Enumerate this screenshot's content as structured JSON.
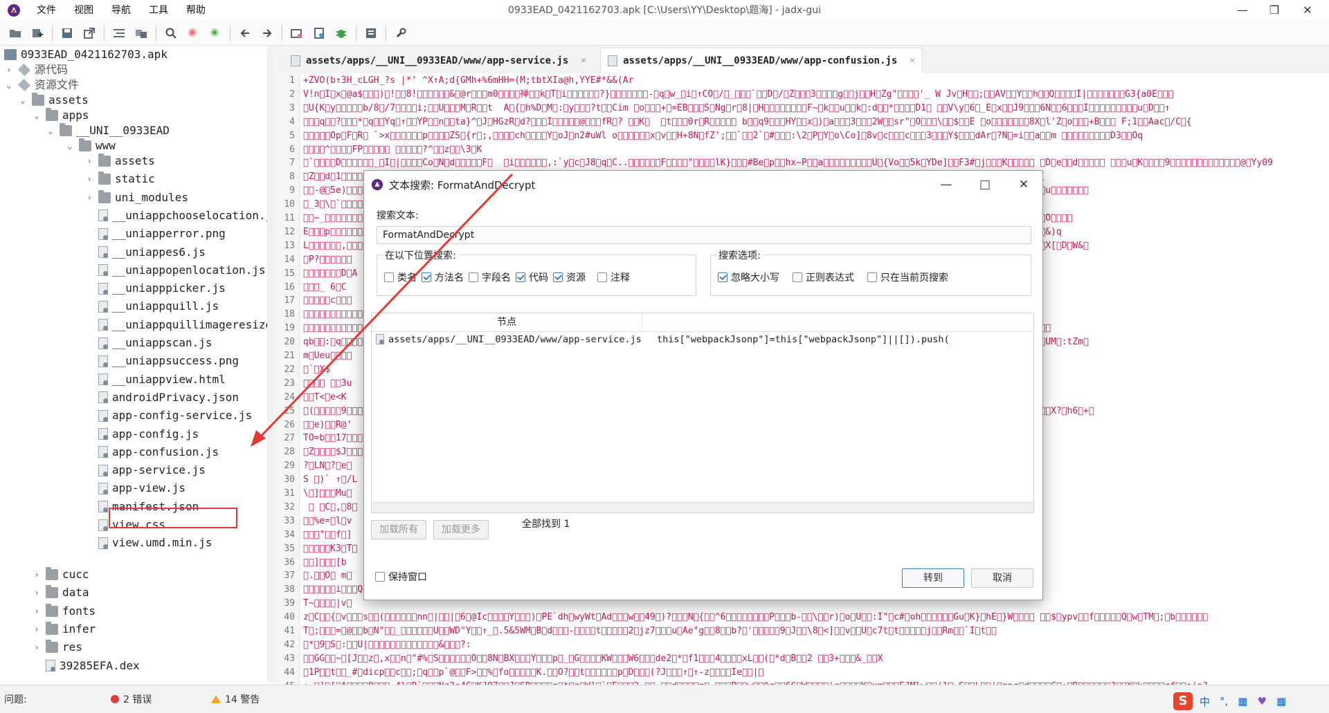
{
  "window": {
    "title": "0933EAD_0421162703.apk [C:\\Users\\YY\\Desktop\\题海] - jadx-gui",
    "menu": [
      "文件",
      "视图",
      "导航",
      "工具",
      "帮助"
    ],
    "controls": {
      "minimize": "—",
      "maximize": "❐",
      "close": "✕"
    }
  },
  "tabs": [
    {
      "label": "assets/apps/__UNI__0933EAD/www/app-service.js",
      "close": "✕"
    },
    {
      "label": "assets/apps/__UNI__0933EAD/www/app-confusion.js",
      "close": "✕"
    }
  ],
  "tree": {
    "root": "0933EAD_0421162703.apk",
    "source": "源代码",
    "resources": "资源文件",
    "assets": "assets",
    "apps": "apps",
    "uni": "__UNI__0933EAD",
    "www": "www",
    "items": [
      "assets",
      "static",
      "uni_modules",
      "__uniappchooselocation.js",
      "__uniapperror.png",
      "__uniappes6.js",
      "__uniappopenlocation.js",
      "__uniapppicker.js",
      "__uniappquill.js",
      "__uniappquillimageresize.js",
      "__uniappscan.js",
      "__uniappsuccess.png",
      "__uniappview.html",
      "androidPrivacy.json",
      "app-config-service.js",
      "app-config.js",
      "app-confusion.js",
      "app-service.js",
      "app-view.js",
      "manifest.json",
      "view.css",
      "view.umd.min.js"
    ],
    "after": [
      "cucc",
      "data",
      "fonts",
      "infer",
      "res",
      "39285EFA.dex"
    ]
  },
  "editor": {
    "line_numbers": [
      "1",
      "2",
      "3",
      "4",
      "5",
      "6",
      "7",
      "8",
      "9",
      "10",
      "11",
      "12",
      "13",
      "14",
      "15",
      "16",
      "17",
      "18",
      "19",
      "20",
      "21",
      "22",
      "23",
      "24",
      "25",
      "26",
      "27",
      "28",
      "29",
      "30",
      "31",
      "32",
      "33",
      "34",
      "35",
      "36",
      "37",
      "38",
      "39",
      "40",
      "41",
      "42",
      "43",
      "44",
      "45"
    ],
    "lines": [
      "\u0001+\u0000\u0001ZVO(\u0000\u0000b\u0000↑\u0000\u0000\u00003\u0000\u0000\u0000H\u0000_cL\u0000GH_?\u0000\u0000\u0000s\u0000 |*\u0000\u0000'\u0000\u0000\u0000 ^X\u0000↑\u0000\u0000A;\u0000\u0000d\u0000{\u0000G\u0000M\u0000\u0000\u0000\u0000\u0000h+\u0000\u0000%\u00006m\u0000H\u0000H\u0000\u0000\u0000\u0000=\u0000\u0000\u0000\u0000\u0000\u0000(\u0000\u0000\u0000\u0000\u0000M;\u0000\u0000\u0000t\u0000b\u0000tX\u0000\u0000\u0000I\u0000\u0000\u0000a@\u0000h\u0000\u0000,Y\u0000YE\u0000#*\u0000\u0000&\u0000\u0000\u0000&\u0000(\u0000A\u0000\u0000\u0000\u0000\u0000\u0000\u0000r\u0000\u0000\u0000",
      "V!n\u0000I\u0000x\u0000@a$\u0000\u0000\u0000)\u0000!\u0000\u00008!\u0000\u0000\u0000\u0000\u0000\u0000&\u0000@r\u0000\u0000\u0000m0\u0000\u0000\u0000\u0000禅\u0000\u0000k\u0000T\u0000i\u0000\u0000\u0000\u0000\u0000\u0000?}\u0000\u0000\u0000\u0000\u0000\u0000\u0000-\u0000q\u0000w_\u0000i\u0000↑CO\u0000/\u0000_\u0000\u0000\u0000`\u0000\u0000D\u0000/\u0000Z\u0000\u0000\u00003\u0000\u0000\u0000\u0000g\u0000\u0000j\u0000\u0000H\u0000Zg\"\u0000\u0000\u0000\u0000'_ W Jv\u0000H\u0000\u0000;\u0000\u0000AV\u0000\u0000Y\u0000\u0000h\u0000\u0000Q\u0000\u0000\u0000\u0000I|\u0000\u0000\u0000\u0000\u0000\u0000\u0000G3{a0E\u0000\u0000\u0000",
      "\u0000U{K\u0000y\u0000\u0000\u0000\u0000\u0000b/8\u0000/7\u0000\u0000\u0000\u0000i;\u0000\u0000U\u0000\u0000\u0000M\u0000R\u0000\u0000t  A\u0000{\u0000h%D\u0000M\u0000:\u0000y\u0000\u0000\u0000?t\u0000\u0000Cim \u0000o\u0000\u0000\u0000+\u0000=EB\u0000\u0000\u0000S\u0000Ng\u0000r\u00008|\u0000H\u0000\u0000\u0000\u0000\u0000\u0000\u0000\u0000F~\u0000k\u0000\u0000u\u0000\u0000k\u0000:d\u0000\u0000*\u0000\u0000\u0000\u0000D1\u0000 \u0000\u0000V\\y\u00006\u0000_E\u0000x\u0000\u0000J9\u0000\u0000\u00006N\u0000\u00006\u0000\u0000\u0000I\u0000\u0000\u0000\u0000\u0000\u0000\u0000\u0000\u0000u\u0000D\u0000\u0000↑",
      "\u0000\u0000\u0000q\u0000\u0000?\u0000\u0000\u0000*\u0000q\u0000\u0000Yq\u0000↑\u0000\u0000YP\u0000\u0000n\u0000\u0000ta}^\u0000J\u0000HGzR\u0000d?\u0000\u0000\u0000I\u0000\u0000\u0000\u0000\u0000@\u0000\u0000\u0000fR\u0000? \u0000\u0000K\u0000  \u0000t\u0000\u0000\u00000r\u0000R\u0000\u0000\u0000\u0000\u0000 b\u0000\u0000q9\u0000\u0000\u0000HY\u0000\u0000x\u0000)\u0000a\u0000\u0000\u00003\u0000\u0000\u00002W\u0000\u0000sr\"\u0000O\u0000\u0000\u0000\\\u0000\u0000$\u0000\u0000E \u0000o\u0000\u0000\u0000\u0000\u0000\u0000\u00008X\u0000l'Z\u0000o\u0000\u0000\u0000+B\u0000\u0000\u0000 F;1\u0000\u0000Aac\u0000/C\u0000{",
      "\u0000\u0000\u0000\u0000\u0000Op\u0000F\u0000R\u0000 `>x\u0000\u0000\u0000\u0000\u0000\u0000p\u0000\u0000\u0000\u0000ZS\u0000{r\u0000;,\u0000\u0000\u0000\u0000ch\u0000\u0000\u0000\u0000Y\u0000oJ\u0000n2#uWl o\u0000\u0000\u0000\u0000\u0000\u0000x\u0000v\u0000\u0000H+8N\u0000fZ';\u0000\u0000`\u0000\u00002`\u0000#\u0000\u0000\u0000:\\2\u0000P\u0000Y\u0000o\\Co]\u00008v\u0000c\u0000\u0000\u0000c\u0000\u0000\u00003\u0000\u0000\u0000Y$\u0000\u0000\u0000dAr\u0000?N\u0000=i\u0000\u0000a\u0000\u0000m \u0000\u0000\u0000\u0000\u0000\u0000\u0000\u0000\u0000D3\u0000\u0000Oq",
      "\u0000\u0000\u0000\u0000^\u0000\u0000\u0000\u0000FP\u0000\u0000\u0000\u0000\u0000 \u0000\u0000\u0000\u0000\u0000?^\u0000\u0000z\u0000\u0000\\3\u0000K",
      "\u0000`\u0000\u0000\u0000\u0000D\u0000\u0000\u0000\u0000\u0000\u0000_\u0000I\u0000|\u0000\u0000\u0000\u0000Co\u0000N\u0000d\u0000\u0000\u0000\u0000\u0000F\u0000  \u0000i\u0000\u0000\u0000\u0000\u0000\u0000,:`y\u0000c\u0000J8\u0000q\u0000C..\u0000\u0000\u0000\u0000\u0000\u0000F\u0000\u0000\u0000\u0000\"\u0000\u0000\u0000\u0000lK}\u0000\u0000\u0000#Be\u0000p\u0000\u0000hx~P\u0000\u0000a\u0000\u0000\u0000\u0000\u0000\u0000\u0000\u0000\u0000U\u0000{Vo\u0000\u00005k\u0000YDe]\u0000\u0000F3#\u0000j\u0000\u0000\u0000K\u0000\u0000\u0000\u0000\u0000 \u0000D\u0000e\u0000\u0000d\u0000\u0000\u0000\u0000\u0000 \u0000\u0000\u0000u\u0000K\u0000\u0000\u0000\u00009\u0000\u0000\u0000\u0000\u0000\u0000\u0000\u0000\u0000\u0000\u0000\u0000\u0000@\u0000Yy09",
      "\u0000Z\u0000\u0000d\u00001\u0000\u0000\u0000\u0000\u0000\u0000\u0000\u0000\u0000\u0000\u0000\u0000\u0000\u0000\u0000\u0000\u0000\u0000\u0000\u0000\u0000\u0000\u0000\u0000\u0000\u0000\u0000\u0000\u0000\u0000\u0000\u0000\u0000\u0000\u0000\u0000\u0000\u0000\u0000\u0000\u0000\u0000\u0000\u0000\u0000\u0000\u0000\u0000\u0000\u0000\u0000\u0000\u0000\u0000\u0000\u0000\u0000\u0000\u0000\u0000\u0000\u0000\u0000\u0000\u0000\u0000\u0000\u0000\u0000\u0000\u0000\u0000\u0000\u0000\u0000\u0000\u0000\u0000\u0000\u0000\u0000\u0000\u0000\u0000\u0000\u0000\u0000\u0000\u0000\u0000\u0000e\u0000#+\u00003+y    \u0000\u0000\u0000\u0000Sx6\u0000O\u0000\u0000\u00004\u0000\u0000\u0000\u0000\u0000i\u0000\u0000h9I \u0000(",
      "\u0000\u0000-@\u00005e)\u0000\u0000\u0000\u0000\u0000\u0000\u0000\u0000\u0000\u0000\u0000\u0000\u0000\u0000\u0000\u0000\u0000\u0000\u0000\u0000\u0000\u0000\u0000\u0000\u0000\u0000\u0000\u0000\u0000\u0000\u0000\u0000\u0000\u0000\u0000\u0000\u0000\u0000\u0000\u0000\u0000\u0000\u0000\u0000\u0000\u0000\u0000\u0000\u0000\u0000\u0000\u0000\u0000\u0000\u0000\u0000\u0000\u0000\u0000\u0000\u0000\u0000\u0000\u0000\u0000\u0000\u0000\u0000\u0000\u0000\u0000\u0000\u0000\u0000\u0000\u0000\u0000\u0000\u0000\u0000\u0000\u0000\u0000\u0000\u0000\u0000\u0000\u0000\u0000\u0000\u0000$o\u0000\u0000gV)eX\u0000aM\u0000\u0000\u0000dw\u0000\u0000\u0000\u0000\u0000\u0000\u0000\u0000-\u0000-\u0000\u0000-N\u00001I\u0000a\u0000u\u0000\u0000\u0000\u0000\u0000\u0000\u0000",
      "\u0000_3\u0000\\\u0000`\u0000\u0000\u0000\u0000\u0000\u0000\u0000\u0000\u0000\u0000\u0000\u0000\u0000\u0000\u0000\u0000\u0000\u0000\u0000\u0000\u0000\u0000\u0000\u0000\u0000\u0000\u0000\u0000\u0000\u0000\u0000\u0000\u0000\u0000\u0000\u0000\u0000\u0000\u0000\u0000\u0000\u0000\u0000\u0000\u0000\u0000\u0000\u0000\u0000\u0000\u0000\u0000\u0000\u0000\u0000\u0000\u0000\u0000\u0000\u0000\u0000\u0000\u0000\u0000\u0000\u0000\u0000\u0000\u0000\u0000\u0000\u0000\u0000\u0000\u0000\u0000\u0000\u0000\u0000\u0000\u0000\u0000\u0000\u0000\u0000\u0000\u0000\u0000\u0000\u0000-F11\u0000\u0000\\k\u0000\u0000\u0000Q^.ni\u0000\u0000\u0000\u0000X0Wq\u0000Qc\u0000\u0000\u0000\u0000",
      "\u0000\u0000~_\u0000\u0000\u0000\u0000\u0000\u0000\u0000\u0000\u0000\u0000\u0000\u0000\u0000\u0000\u0000\u0000\u0000\u0000\u0000\u0000\u0000\u0000\u0000\u0000\u0000\u0000\u0000\u0000\u0000\u0000\u0000\u0000\u0000\u0000\u0000\u0000\u0000\u0000\u0000\u0000\u0000\u0000\u0000\u0000\u0000\u0000\u0000\u0000\u0000\u0000\u0000\u0000\u0000\u0000\u0000\u0000\u0000\u0000\u0000\u0000\u0000\u0000\u0000\u0000\u0000\u0000\u0000\u0000\u0000\u0000\u0000\u0000\u0000\u0000\u0000\u0000\u0000\u0000\u0000\u0000\u0000\u0000\u0000\u0000\u0000\u0000\u0000\u0000\u0000\u0000\u0000\u0000\u0000\u0000↑t_&\u0000}Y\u0000o\"\u0000\u0000\u0000\u0000;\u0000!)\u0000\u0000\u0000>\u0000\u0000\u0000\u0000e\u0000~ \u0000\u0000\u0000{\u0000X\u0000d\u0000O\u0000\u0000\u0000\u0000",
      "E\u0000\u0000\u0000p\u0000\u0000\u0000\u0000\u0000\u0000\u0000\u0000\u0000\u0000\u0000\u0000\u0000\u0000\u0000\u0000\u0000\u0000\u0000\u0000\u0000\u0000\u0000\u0000\u0000\u0000\u0000\u0000\u0000\u0000\u0000\u0000\u0000\u0000\u0000\u0000\u0000\u0000\u0000\u0000\u0000\u0000\u0000\u0000\u0000\u0000\u0000\u0000\u0000\u0000\u0000\u0000\u0000\u0000\u0000\u0000\u0000\u0000\u0000\u0000\u0000\u0000\u0000\u0000\u0000\u0000\u0000\u0000\u0000\u0000\u0000\u0000\u0000\u0000\u0000\u0000\u0000\u0000\u0000\u0000\u0000\u0000\u0000\u0000\u0000\u0000\u0000\u0000\u0000\u0000\u0000\u0000\u0000U\u0000\u0000\u0000\u0000\u0000\u00005f\u0000\u0000T8:\u0000~;\u0000\u0000\u0000\u0000\u0000\u0000\u0000*Y\u0000\u0000\u00008\u0000\u0000\u0000|1_P\u0000\u0000&)q",
      "L\u0000\u0000\u0000\u0000\u0000\u0000,\u0000\u0000\u0000\u0000\u0000\u0000\u0000\u0000\u0000\u0000\u0000\u0000\u0000\u0000\u0000\u0000\u0000\u0000\u0000\u0000\u0000\u0000\u0000\u0000\u0000\u0000\u0000\u0000\u0000\u0000\u0000\u0000\u0000\u0000\u0000\u0000\u0000\u0000\u0000\u0000\u0000\u0000\u0000\u0000\u0000\u0000\u0000\u0000\u0000\u0000\u0000\u0000\u0000\u0000\u0000\u0000\u0000\u0000\u0000\u0000\u0000\u0000\u0000\u0000\u0000\u0000\u0000\u0000\u0000\u0000\u0000\u0000\u0000\u0000\u0000\u0000\u0000\u0000\u0000\u0000\u0000\u0000\u0000\u0000\u0000\u0000\u0000\u0000\u0000\u0000\u0000\u0000 \u0000 \u0000\u0000\u0000\u0000b\u0000K6{^\u0000o\u0000\u0000\u0000%\u0000\u0000Y\u0000\u0000_\u0000\u0000\u0000\u0000\u0000\u0000 {\u0000\u0000}\u0000X[\u0000D\u0000W&\u0000",
      "\u0000P?\u0000\u0000\u0000\u0000\u0000\u0000",
      "\u0000\u0000\u0000\u0000\u0000\u0000\u0000D\u0000A",
      "\u0000\u0000\u0000_ 6\u0000C",
      "\u0000\u0000\u0000\u0000\u0000c\u0000\u0000\u0000",
      "\u0000\u0000\u0000\u0000\u0000\u0000\u0000\u0000\u0000\u0000\u0000\u0000\u0000\u0000\u0000\u0000\u0000\u0000\u0000\u0000\u0000\u0000\u0000\u0000\u0000\u0000\u0000\u0000\u0000\u0000\u0000\u0000\u0000\u0000\u0000\u0000\u0000\u0000\u0000\u0000\u0000\u0000\u0000\u0000\u0000\u0000\u0000\u0000\u0000\u0000\u0000\u0000\u0000\u0000\u0000\u0000\u0000\u0000\u0000\u0000\u0000\u0000\u0000\u0000\u0000\u0000\u0000\u0000\u0000\u0000\u0000\u0000\u0000\u0000\u0000\u0000\u0000\u0000\u0000\u0000\u0000\u0000\u0000\u0000\u0000\u0000\u0000\u0000\u0000\u0000\u0000\u0000\u0000\u0000\u0000\u0000\u0000\u0000\u0000\u0000\u0000\u0000\u0000\u0000\u0000\u0000\u0000\u0000\u0000\u0000\u0000v\u0000\u0000x-\u0000y\u0000W\u0000\u0000]c\u0000\u0000\u0000\u0000",
      "\u0000\u0000\u0000\u0000\u0000\u0000\u0000\u0000\u0000\u0000\u0000\u0000\u0000\u0000\u0000\u0000\u0000\u0000\u0000\u0000\u0000\u0000\u0000\u0000\u0000\u0000\u0000\u0000\u0000\u0000\u0000\u0000\u0000\u0000\u0000\u0000\u0000\u0000\u0000\u0000\u0000\u0000\u0000\u0000\u0000\u0000\u0000\u0000\u0000\u0000\u0000\u0000\u0000\u0000\u0000\u0000\u0000\u0000\u0000\u0000\u0000\u0000\u0000\u0000\u0000\u0000\u0000\u0000\u0000\u0000\u0000\u0000\u0000\u0000\u0000\u0000\u0000\u0000\u0000\u0000\u0000\u0000\u0000\u0000\u0000\u0000\u0000\u0000\u0000\u0000\u0000\u0000\u0000\u0000\u0000\u0000\u0000K  }K\u0000R\u0000H\u0000\u0000\u0000\u0000\u0000\"u\u0000\u0000p_n\u0000\u0000\u0000x\u0000!\u0000\u0000\u0000\u0000\u0000-\u0000-\u0000\u0000\u0000\u0000\u0000\u0000",
      "qb\u0000\u0000:\u0000q\u0000\u0000\u0000\u0000\u0000\u0000\u0000\u0000\u0000\u0000\u0000\u0000\u0000\u0000\u0000\u0000\u0000\u0000\u0000\u0000\u0000\u0000\u0000\u0000\u0000\u0000\u0000\u0000\u0000\u0000\u0000\u0000\u0000\u0000\u0000\u0000\u0000\u0000\u0000\u0000\u0000\u0000\u0000\u0000\u0000\u0000\u0000\u0000\u0000\u0000\u0000\u0000\u0000\u0000\u0000\u0000\u0000\u0000\u0000\u0000\u0000\u0000\u0000\u0000\u0000\u0000\u0000\u0000\u0000\u0000\u0000\u0000\u0000\u0000\u0000\u0000\u0000\u0000\u0000\u0000\u0000\u0000\u0000\u0000\u0000\u0000\u0000\u0000\u0000\u0000\u0000\u0000\u0000\u0000xD[\u0000\u0000\u0000\u0000\u0000\u0000\u0000U\u0000a\u0000\u0000\u0000↑1\u0000\u0000\u0000Ka\u0000\u0000Y\u0000\u0000\u0000n\u0000 \u0000w\u0000\u0000UM\u0000:tZm\u0000",
      "m\u0000Ueu\u0000\u0000\u0000\u0000",
      "\u0000`\u0000X$",
      "\u0000\u0000\u0000\u0000 \u0000\u00003u",
      "\u0000\u0000T<\u0000e<K",
      "\u0000(\u0000\u0000\u0000\u0000\u00009\u0000\u0000\u0000\u0000\u0000\u0000\u0000\u0000\u0000\u0000\u0000\u0000\u0000\u0000\u0000\u0000\u0000\u0000\u0000\u0000\u0000\u0000\u0000\u0000\u0000\u0000\u0000\u0000\u0000\u0000\u0000\u0000\u0000\u0000\u0000\u0000\u0000\u0000\u0000\u0000\u0000\u0000\u0000\u0000\u0000\u0000\u0000\u0000\u0000\u0000\u0000\u0000\u0000\u0000\u0000\u0000\u0000\u0000\u0000\u0000\u0000\u0000\u0000\u0000\u0000\u0000\u0000\u0000\u0000\u0000\u0000\u0000\u0000\u0000\u0000\u0000\u0000\u0000\u0000\u0000\u0000\u0000\u0000\u0000\u0000\u0000\u0000\u0000\u0000\u0000\u0000N\u0000\u0000\u0000\u0000\u0000\u0000o+\u0000U:\u0000\u0000\u0000(\u0000\u0000q\u0000v\u0000\u0000\u0000\u0000\u0000Z\u0000\u0000\u0000\u0000i\u0000\u0000%\u0000\u0000\u0000\u0000X?\u0000h6\u0000+\u0000",
      "\u0000\u0000e)\u0000\u0000R@'",
      "TO=b\u0000\u000017\u0000\u0000\u0000",
      "\u0000Z\u0000\u0000\u0000\u0000$J\u0000\u0000\u0000",
      "?\u0000LN\u0000?\u0000e\u0000",
      "S \u0000)` ↑\u0000/L",
      "\\\u0000]\u0000\u0000\u0000Mu\u0000",
      " \u0000 \u0000C\u0000,\u00008\u0000",
      "\u0000\u0000%e=\u0000l\u0000v",
      "\u0000\u0000\u0000\"\u0000\u0000f\u0000]",
      "\u0000\u0000\u0000\u0000\u0000K3\u0000T\u0000",
      "\u0000\u0000]\u0000\u0000\u0000[b",
      "\u0000.\u0000\u0000O\u0000 m\u0000",
      "\u0000\u0000\u0000\u0000\u0000\u0000i\u0000\u0000\u0000Q",
      "T~\u0000\u0000\u0000\u0000|v\u0000",
      "z\u0000C\u0000\u0000{\u0000v\u0000\u0000\u0000s\u0000\u0000(\u0000\u0000\u0000\u0000\u0000\u0000nn\u0000|\u0000\u0000|\u00006\u0000@Ic\u0000\u0000\u0000\u0000Y\u0000\u0000\u0000)\u0000PE`dh\u0000wyWt\u0000Ad\u0000\u0000\u0000w\u0000\u000049\u0000)?\u0000\u0000\u0000N\u0000{\u0000\u0000^6\u0000\u0000\u0000\u0000\u0000\u0000\u0000\u0000P\u0000\u0000\u0000b-\u0000\u0000\\\u0000\u0000r)\u0000o\u0000U\u0000\u0000:I\"\u0000c#\u0000oh\u0000\u0000\u0000\u0000\u0000\u0000Gu\u0000K}\u0000hE\u0000}W\u0000\u0000\u0000\u0000 \u0000\u0000$\u0000ypv\u0000\u0000f\u0000\u0000\u0000\u0000\u0000Q\u0000w\u0000TM\u0000;\u0000b\u0000\u0000\u0000\u0000\u0000\u0000",
      "T\u0000;\u0000\u0000\u0000=\u0000@\u0000\u0000b\u0000N\"\u0000\u0000_\u0000\u0000\u0000\u0000\u0000\u0000U\u0000\u0000WD\"Y\u0000\u0000↑_\u0000.5&5WM\u0000B\u0000d\u0000\u0000\u0000-\u0000\u0000\u0000\u0000t\u0000\u0000\u0000\u0000\u00002\u0000jz7\u0000\u0000\u0000u\u0000Ae\"g\u0000\u00008\u0000\u0000b?\u0000'\u0000\u0000\u0000\u0000\u00009\u0000J\u0000\u0000\\8\u0000<]\u0000\u0000v\u0000\u0000U\u0000c7t\u0000t\u0000\u0000\u0000\u0000\u0000j\u0000\u0000Rm\u0000\u0000`I\u0000t\u0000\u0000",
      "\u0000*\u00009\u0000S\u0000:\u0000\u0000U|\u0000\u0000\u0000\u0000\u0000\u0000\u0000\u0000\u0000\u0000\u0000\u0000\u0000&\u0000\u0000\u0000?:",
      "\u0000\u0000GG\u0000\u0000~\u0000[J\u0000\u0000z\u0000,x\u0000\u0000n\u0000\"#%\u0000S\u0000\u0000\u0000\u0000\u0000\u0000O\u0000\u00008N\u0000BX\u0000\u0000\u0000Y\u0000\u0000\u0000p\u0000_\u0000G\u0000\u0000\u0000\u0000KW\u0000\u0000\u0000W6\u0000\u0000\u0000de2\u0000*\u0000f1\u0000\u0000\u00004\u0000\u0000\u0000\u0000xL\u0000\u0000(\u0000*d\u0000B\u0000\u00002 \u0000\u00003+\u0000\u0000\u0000&_\u0000\u0000X",
      "\u00001P\u0000\u0000t\u0000\u0000_#\u0000dicp\u0000\u0000c\u0000\u0000;\u0000q\u0000\u0000p`@\u0000\u0000F>\u0000\u0000%\u0000fo\u0000\u0000\u0000\u0000\u0000K.\u0000\u0000O?\u0000\u0000t\u0000\u0000\u0000\u0000\u0000\u0000p\u0000D\u0000\u0000\u0000(?J\u0000\u0000\u0000↑\u0000↑-z\u0000\u0000\u0000\u0000Ie\u0000\u0000|\u0000",
      "+ \u0000]\u0000[\u0000A\u0000\u0000\u0000\u00008\u0000\u0000\u0000,4}\u0000B`\u0000\u0000\u0000Nz2o4G\u0000KJO7\u0000\u0000J\u0000SR\u0000\u0000\u0000\u0000g\u0000*\u0000z\u0000W]\u0000`\u0000E\u0000\u0000\u00002,\u0000\u0000_\u0000\u0000d\u0000\u0000\u0000\u0000g\u0000 \u0000\u0000\u0000P\u0000\u0000w\u0000\u0000^q\u0000\u00006C\u0000W\u0000\u0000\u0000\u0000|c\u0000\u0000\u0000\u0000K\u0000xm\u0000\u0000\u0000EJMlw\u0000\u0000(1\u0000.S\u0000\u0000L\u0000\u0000'\u0000qpr\u0000d\u0000\u0000\u0000\u0000C\u0000+\u0000B\u0000\u0000\u0000\u0000\u0000\u0000?\u0000\u0000X\u0000k\u0000\u0000\u0000\u0000qf\u0000\u0000o(p?",
      "\u0000\u0000\u0000\u0000Js!\u0000\u0000\u0000\u0000\u0000\u0000\u0000\u0000\u0000jk\u0000\u0000\u0000t\u0000\u0000bSs\u0000\u0000\\\u0000\u0000\u00002\u0000\u0000\u0000\u0000)\u0000\u0000M  \u0000f\u0000\u0000\u0000}4\u0000G;\u0000f\u0000\u0000a`\u00003p\u0000\u0000gs\u0000^\u0000\u0000\u0000W\u0000/\u0000\u0000\u0000M\u00001\u0000\u0000\u0000\u0000 \u0000\u0000\u0000Z\u0000\u0000R9Yq\u0000\u0000\u0000\u0000Gi\u0000\u0000/\u0000\u0000\u0000\u0000\u0000\u0000\u0000\u0000st&\u0000\u0000\u0000 \u0000\u0000#\u0000-\u0000\u0000\u0000\u0000w[M\u0000&*\u0000\u0000\u0000\u0000C\u0000\u0000\u0000\u0000"
    ]
  },
  "status": {
    "problems_label": "问题:",
    "errors": "2 错误",
    "warnings": "14 警告"
  },
  "ime": {
    "logo": "S",
    "lang": "中",
    "punct": "°,",
    "kbd": "▦",
    "skin": "♥",
    "menu": "▦"
  },
  "dialog": {
    "title": "文本搜索: FormatAndDecrypt",
    "search_label": "搜索文本:",
    "search_value": "FormatAndDecrypt",
    "search_in_title": "在以下位置搜索:",
    "search_in": [
      {
        "label": "类名",
        "checked": false
      },
      {
        "label": "方法名",
        "checked": true
      },
      {
        "label": "字段名",
        "checked": false
      },
      {
        "label": "代码",
        "checked": true
      },
      {
        "label": "资源",
        "checked": true
      },
      {
        "label": "注释",
        "checked": false
      }
    ],
    "options_title": "搜索选项:",
    "options": [
      {
        "label": "忽略大小写",
        "checked": true
      },
      {
        "label": "正则表达式",
        "checked": false
      },
      {
        "label": "只在当前页搜索",
        "checked": false
      }
    ],
    "results_header": "节点",
    "result": {
      "node": "assets/apps/__UNI__0933EAD/www/app-service.js",
      "code": "this[\"webpackJsonp\"]=this[\"webpackJsonp\"]||[]).push("
    },
    "load_all": "加载所有",
    "load_more": "加载更多",
    "found": "全部找到  1",
    "keep_window": "保持窗口",
    "goto": "转到",
    "cancel": "取消"
  },
  "colors": {
    "code_text": "#c2185b",
    "annotation": "#e53935",
    "accent": "#3d78c6"
  }
}
